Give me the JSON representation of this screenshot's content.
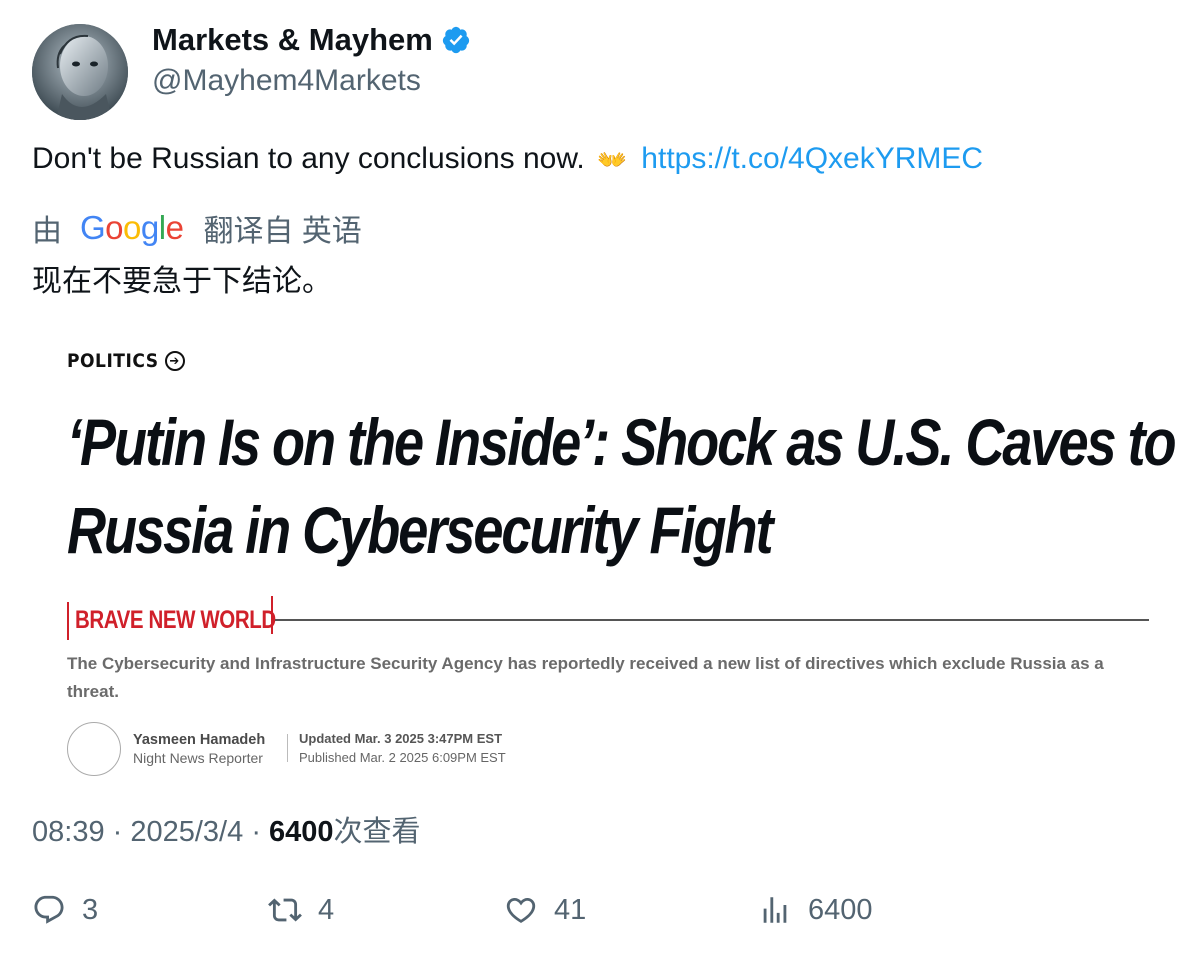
{
  "author": {
    "display_name": "Markets & Mayhem",
    "handle": "@Mayhem4Markets",
    "verified": true
  },
  "tweet": {
    "text": "Don't be Russian to any conclusions now.",
    "emoji": "👐",
    "link": "https://t.co/4QxekYRMEC"
  },
  "translation": {
    "prefix": "由",
    "provider": "Google",
    "suffix": "翻译自 英语",
    "text": "现在不要急于下结论。"
  },
  "card": {
    "section": "POLITICS",
    "headline_line1": "‘Putin Is on the Inside’: Shock as U.S. Caves to",
    "headline_line2": "Russia in Cybersecurity Fight",
    "kicker": "BRAVE NEW WORLD",
    "dek": "The Cybersecurity and Infrastructure Security Agency has reportedly received a new list of directives which exclude Russia as a threat.",
    "author_name": "Yasmeen Hamadeh",
    "author_role": "Night News Reporter",
    "updated": "Updated Mar. 3 2025 3:47PM EST",
    "published": "Published Mar. 2 2025 6:09PM EST"
  },
  "meta": {
    "time": "08:39",
    "date": "2025/3/4",
    "views_count": "6400",
    "views_label": "次查看"
  },
  "actions": {
    "replies": "3",
    "reposts": "4",
    "likes": "41",
    "views": "6400"
  },
  "colors": {
    "link": "#1d9bf0",
    "secondary_text": "#536471",
    "kicker_red": "#d0202a"
  }
}
